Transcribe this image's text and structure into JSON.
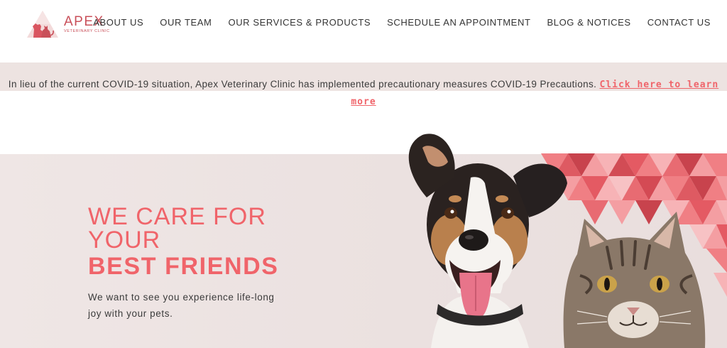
{
  "brand": {
    "name": "APEX",
    "subtitle": "VETERINARY CLINIC",
    "color": "#c9505a"
  },
  "nav": {
    "items": [
      {
        "label": "ABOUT US"
      },
      {
        "label": "OUR TEAM"
      },
      {
        "label": "OUR SERVICES & PRODUCTS"
      },
      {
        "label": "SCHEDULE AN APPOINTMENT"
      },
      {
        "label": "BLOG & NOTICES"
      },
      {
        "label": "CONTACT US"
      }
    ]
  },
  "notice": {
    "text": "In lieu of the current COVID-19 situation, Apex Veterinary Clinic has implemented precautionary measures COVID-19 Precautions. ",
    "link": "Click here to learn more ",
    "link_color": "#f0646a"
  },
  "hero": {
    "line1": "WE CARE FOR",
    "line2": "YOUR",
    "line3": "BEST FRIENDS",
    "subtext": "We want to see you experience life-long joy with your pets.",
    "accent": "#f0646a",
    "image_icon": "dog-and-cat-image"
  }
}
